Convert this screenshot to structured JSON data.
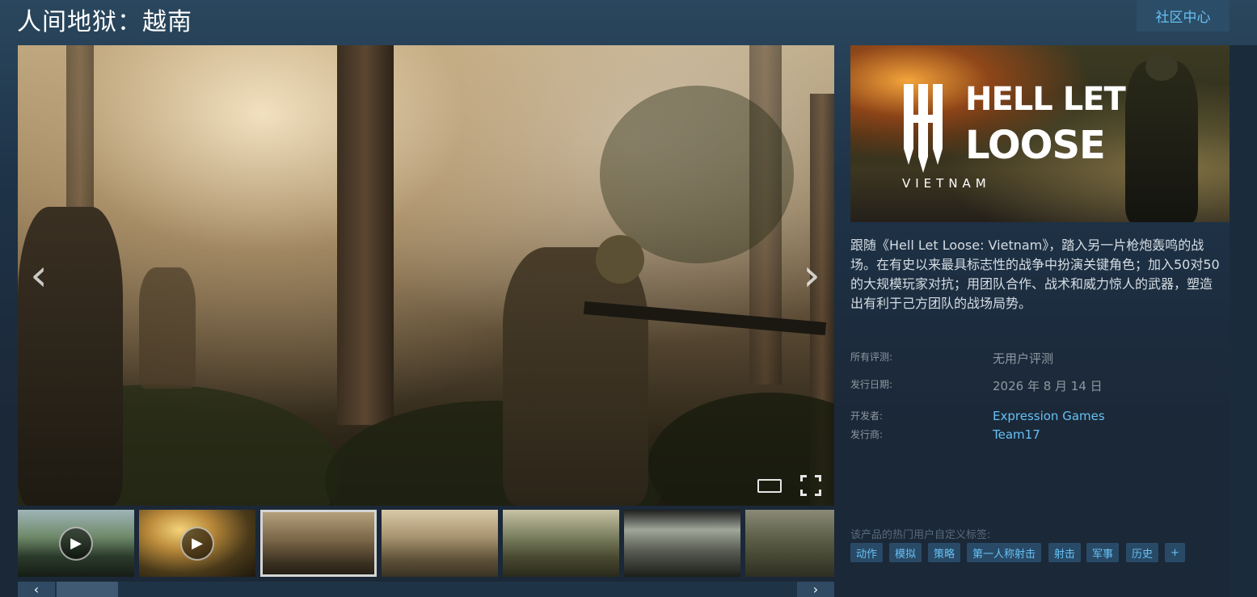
{
  "page": {
    "title": "人间地狱：越南",
    "community_button": "社区中心"
  },
  "media": {
    "prev_icon": "chevron-left-icon",
    "next_icon": "chevron-right-icon",
    "thumbnails": [
      {
        "type": "video"
      },
      {
        "type": "video"
      },
      {
        "type": "image",
        "selected": true
      },
      {
        "type": "image"
      },
      {
        "type": "image"
      },
      {
        "type": "image"
      },
      {
        "type": "image"
      }
    ],
    "slider": {
      "prev": "‹",
      "next": "›"
    }
  },
  "capsule": {
    "logo_line1": "HELL LET",
    "logo_line2": "LOOSE",
    "logo_line3": "VIETNAM"
  },
  "description": "跟随《Hell Let Loose: Vietnam》，踏入另一片枪炮轰鸣的战场。在有史以来最具标志性的战争中扮演关键角色；加入50对50的大规模玩家对抗；用团队合作、战术和威力惊人的武器，塑造出有利于己方团队的战场局势。",
  "info": {
    "reviews_label": "所有评测:",
    "reviews_value": "无用户评测",
    "release_label": "发行日期:",
    "release_value": "2026 年 8 月 14 日",
    "developer_label": "开发者:",
    "developer_value": "Expression Games",
    "publisher_label": "发行商:",
    "publisher_value": "Team17"
  },
  "tags": {
    "label": "该产品的热门用户自定义标签:",
    "items": [
      "动作",
      "模拟",
      "策略",
      "第一人称射击",
      "射击",
      "军事",
      "历史",
      "+"
    ]
  },
  "colors": {
    "background": "#1b2838",
    "link": "#66c0f4",
    "tag_bg": "#294a66"
  }
}
